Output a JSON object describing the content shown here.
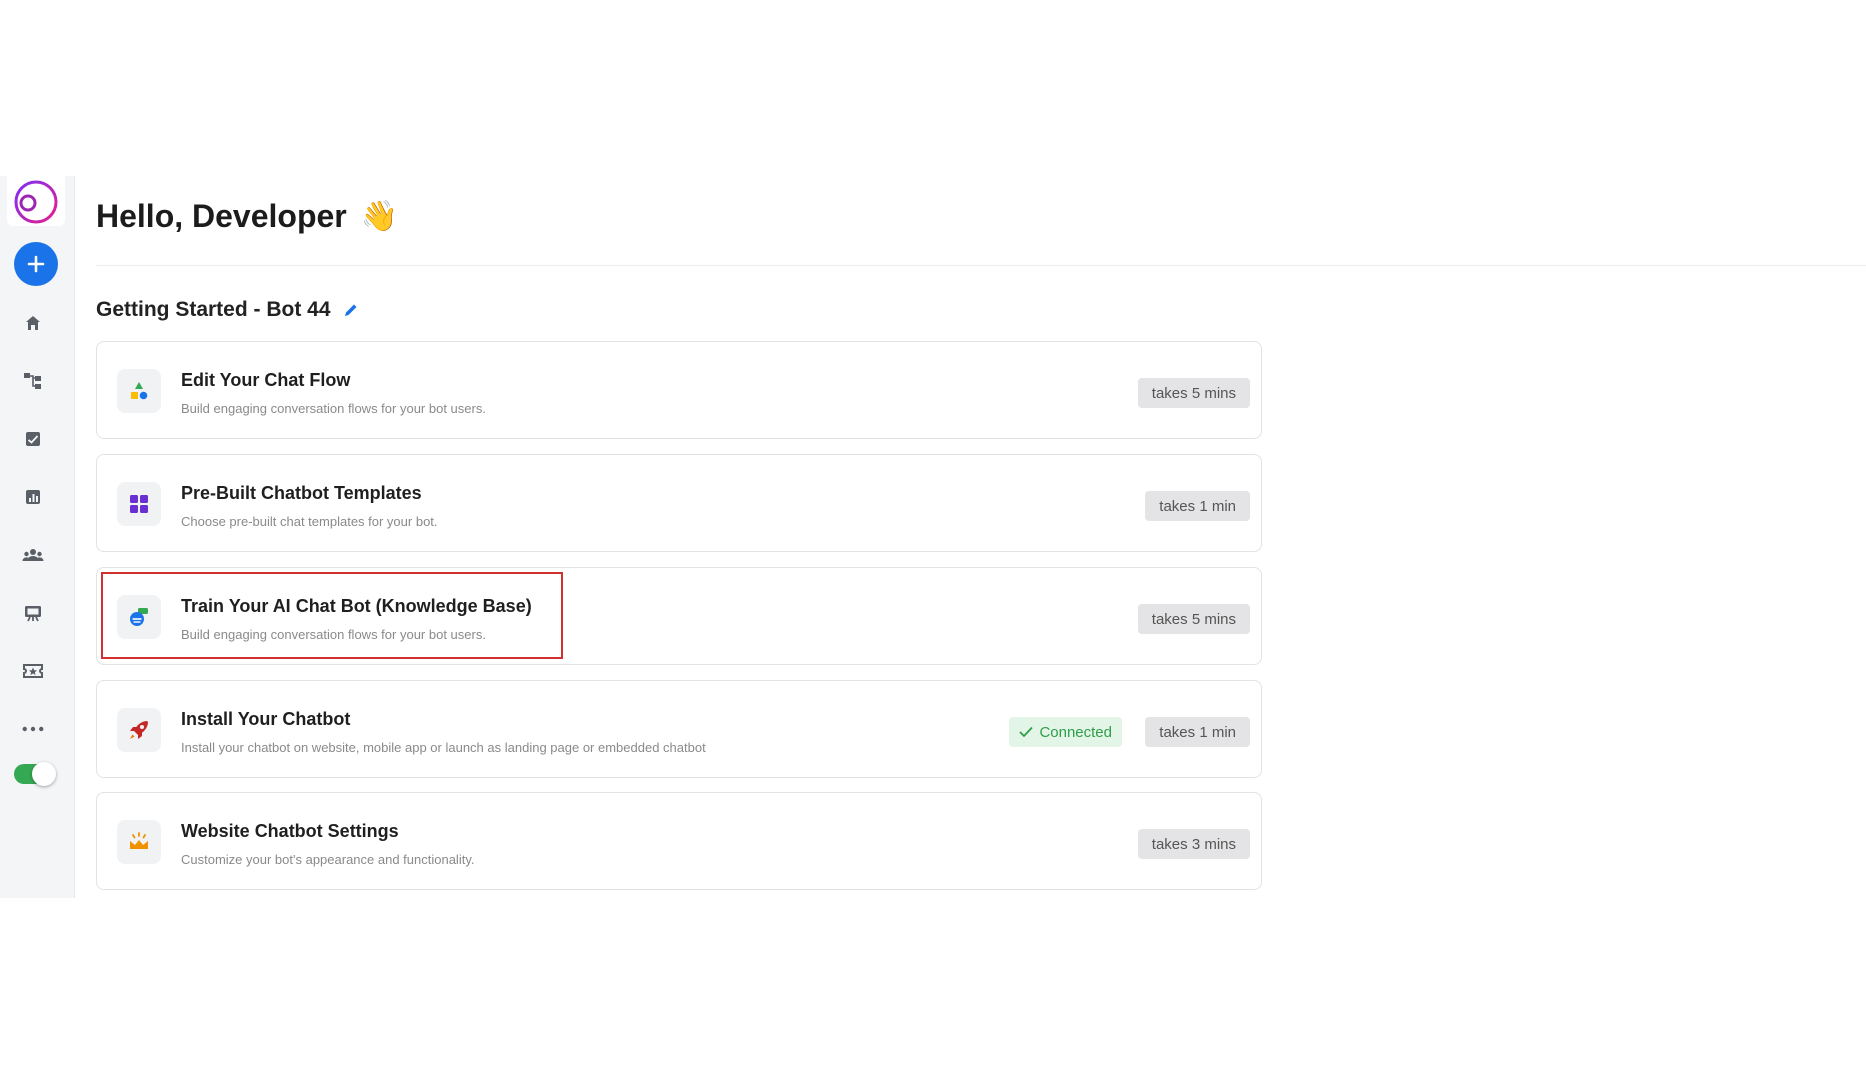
{
  "sidebar": {
    "logo_icon": "app-logo-ring-icon",
    "new_button_icon": "plus-icon",
    "nav_items": [
      {
        "icon": "home-icon"
      },
      {
        "icon": "flow-icon"
      },
      {
        "icon": "inbox-icon"
      },
      {
        "icon": "analytics-icon"
      },
      {
        "icon": "contacts-icon"
      },
      {
        "icon": "broadcast-icon"
      },
      {
        "icon": "ticket-icon"
      },
      {
        "icon": "more-icon"
      }
    ],
    "toggle_on": true
  },
  "header": {
    "greeting": "Hello, Developer",
    "greeting_emoji": "👋"
  },
  "section": {
    "title": "Getting Started - Bot 44"
  },
  "cards": [
    {
      "title": "Edit Your Chat Flow",
      "description": "Build engaging conversation flows for your bot users.",
      "time": "takes 5 mins",
      "icon": "shapes-icon"
    },
    {
      "title": "Pre-Built Chatbot Templates",
      "description": "Choose pre-built chat templates for your bot.",
      "time": "takes 1 min",
      "icon": "grid-icon"
    },
    {
      "title": "Train Your AI Chat Bot (Knowledge Base)",
      "description": "Build engaging conversation flows for your bot users.",
      "time": "takes 5 mins",
      "icon": "knowledge-base-icon",
      "highlighted": true
    },
    {
      "title": "Install Your Chatbot",
      "description": "Install your chatbot on website, mobile app or launch as landing page or embedded chatbot",
      "time": "takes 1 min",
      "status": "Connected",
      "icon": "rocket-icon"
    },
    {
      "title": "Website Chatbot Settings",
      "description": "Customize your bot's appearance and functionality.",
      "time": "takes 3 mins",
      "icon": "settings-crown-icon"
    }
  ],
  "colors": {
    "accent": "#1a73e8",
    "highlight": "#d32f2f",
    "connected": "#2e9e4a",
    "toggle": "#34a853"
  }
}
